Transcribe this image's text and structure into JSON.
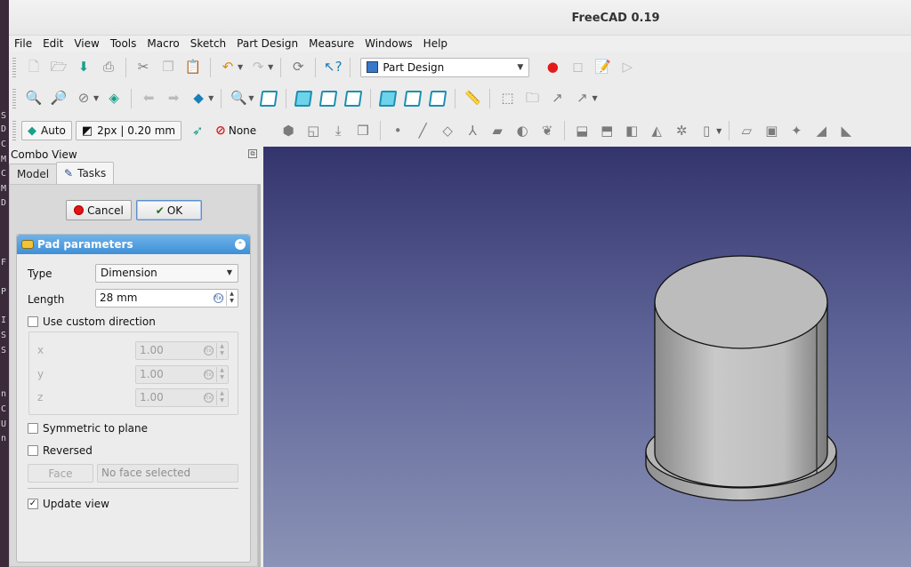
{
  "window": {
    "title": "FreeCAD 0.19"
  },
  "terminal_strip": [
    "S",
    "D",
    "C",
    "M",
    "C",
    "M",
    "D",
    "F",
    "P",
    "I",
    "S",
    "S",
    "n",
    "C",
    "U",
    "n"
  ],
  "menu": [
    "File",
    "Edit",
    "View",
    "Tools",
    "Macro",
    "Sketch",
    "Part Design",
    "Measure",
    "Windows",
    "Help"
  ],
  "toolbar1": {
    "workbench": "Part Design"
  },
  "toolbar3": {
    "draw_style_label": "Auto",
    "line_width_label": "2px | 0.20 mm",
    "snap_label": "None"
  },
  "combo": {
    "title": "Combo View",
    "tabs": [
      "Model",
      "Tasks"
    ]
  },
  "task": {
    "cancel_label": "Cancel",
    "ok_label": "OK",
    "panel_title": "Pad parameters",
    "type_label": "Type",
    "type_value": "Dimension",
    "length_label": "Length",
    "length_value": "28 mm",
    "custom_direction_label": "Use custom direction",
    "custom_direction_checked": false,
    "x_label": "x",
    "x_value": "1.00",
    "y_label": "y",
    "y_value": "1.00",
    "z_label": "z",
    "z_value": "1.00",
    "symmetric_label": "Symmetric to plane",
    "reversed_label": "Reversed",
    "face_button_label": "Face",
    "face_field_value": "No face selected",
    "update_view_label": "Update view",
    "update_view_checked": true
  },
  "colors": {
    "accent": "#3f8fd6",
    "view_top": "#33346c",
    "view_bottom": "#8b93b6",
    "record": "#e01515",
    "model_face": "#bcbcbc"
  },
  "icons": {
    "toolbar1": [
      "new-document-icon",
      "open-icon",
      "save-icon",
      "print-icon",
      "cut-icon",
      "copy-icon",
      "paste-icon",
      "undo-icon",
      "redo-icon",
      "refresh-icon",
      "whats-this-icon",
      "record-macro-icon",
      "stop-macro-icon",
      "edit-macro-icon",
      "run-macro-icon"
    ],
    "toolbar2": [
      "fit-all-icon",
      "fit-selection-icon",
      "draw-style-icon",
      "bounding-box-icon",
      "back-icon",
      "forward-icon",
      "std-views-icon",
      "zoom-icon",
      "isometric-icon",
      "front-icon",
      "top-icon",
      "right-icon",
      "rear-icon",
      "bottom-icon",
      "left-icon",
      "measure-icon",
      "part-icon",
      "group-icon",
      "link-icon",
      "link-actions-icon"
    ]
  }
}
